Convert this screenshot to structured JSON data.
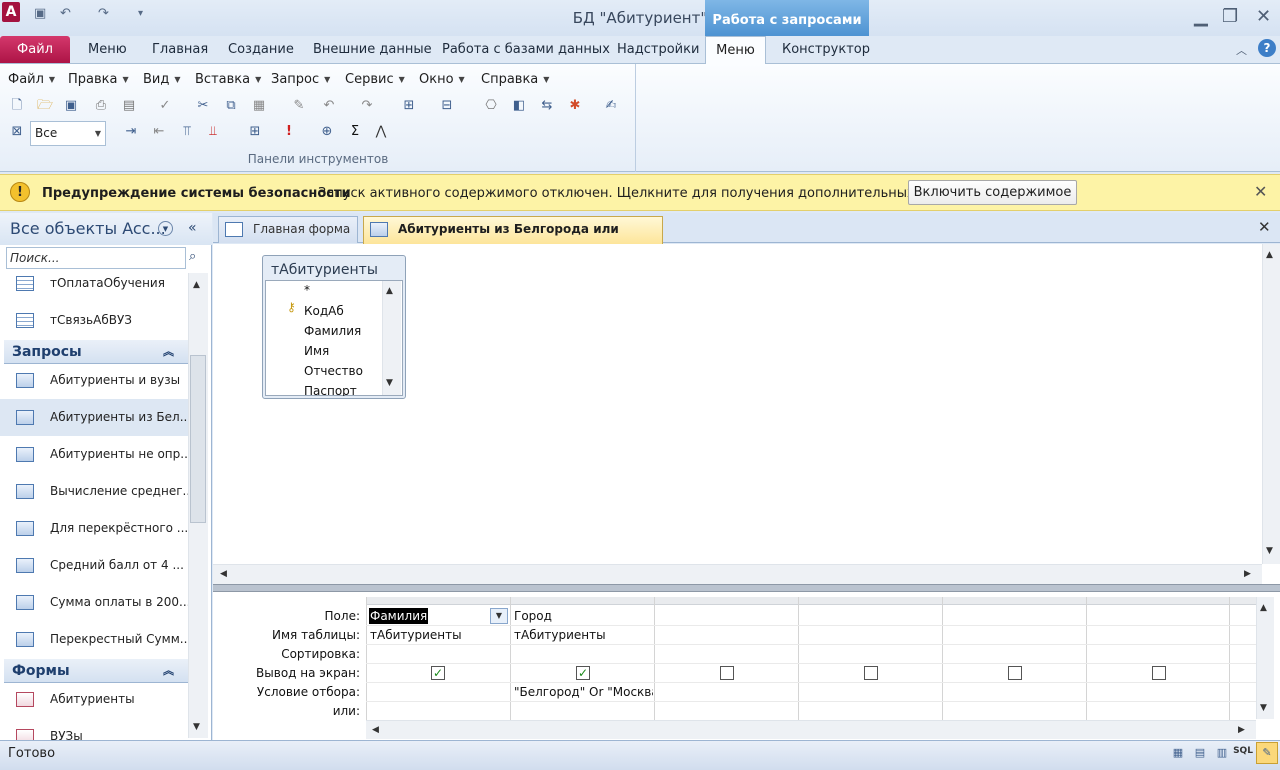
{
  "window": {
    "title": "БД \"Абитуриент\"",
    "context_header": "Работа с запросами"
  },
  "ribbon_tabs": {
    "file": "Файл",
    "menu": "Меню",
    "home": "Главная",
    "create": "Создание",
    "external": "Внешние данные",
    "dbtools": "Работа с базами данных",
    "addins": "Надстройки",
    "menu_active": "Меню",
    "designer": "Конструктор"
  },
  "menubar": [
    "Файл",
    "Правка",
    "Вид",
    "Вставка",
    "Запрос",
    "Сервис",
    "Окно",
    "Справка"
  ],
  "toolbar": {
    "select_value": "Все",
    "group_label": "Панели инструментов"
  },
  "security": {
    "title": "Предупреждение системы безопасности",
    "message": "Запуск активного содержимого отключен. Щелкните для получения дополнительных сведений.",
    "button": "Включить содержимое"
  },
  "nav": {
    "title": "Все объекты Acc...",
    "search_placeholder": "Поиск...",
    "tables": [
      "тОплатаОбучения",
      "тСвязьАбВУЗ"
    ],
    "queries_group": "Запросы",
    "queries": [
      "Абитуриенты и вузы",
      "Абитуриенты из Бел...",
      "Абитуриенты не опр...",
      "Вычисление среднег...",
      "Для перекрёстного ...",
      "Средний балл от 4 ...",
      "Сумма оплаты в 200...",
      "Перекрестный Сумм..."
    ],
    "forms_group": "Формы",
    "forms": [
      "Абитуриенты",
      "ВУЗы"
    ]
  },
  "doc_tabs": {
    "tab1": "Главная форма",
    "tab2": "Абитуриенты из Белгорода или Москвы"
  },
  "table_box": {
    "title": "тАбитуриенты",
    "fields": [
      "*",
      "КодАб",
      "Фамилия",
      "Имя",
      "Отчество",
      "Паспорт"
    ]
  },
  "qbe": {
    "row_labels": [
      "Поле:",
      "Имя таблицы:",
      "Сортировка:",
      "Вывод на экран:",
      "Условие отбора:",
      "или:"
    ],
    "col1": {
      "field": "Фамилия",
      "table": "тАбитуриенты",
      "show": true,
      "criteria": ""
    },
    "col2": {
      "field": "Город",
      "table": "тАбитуриенты",
      "show": true,
      "criteria": "\"Белгород\" Or \"Москва"
    }
  },
  "status": {
    "text": "Готово"
  }
}
